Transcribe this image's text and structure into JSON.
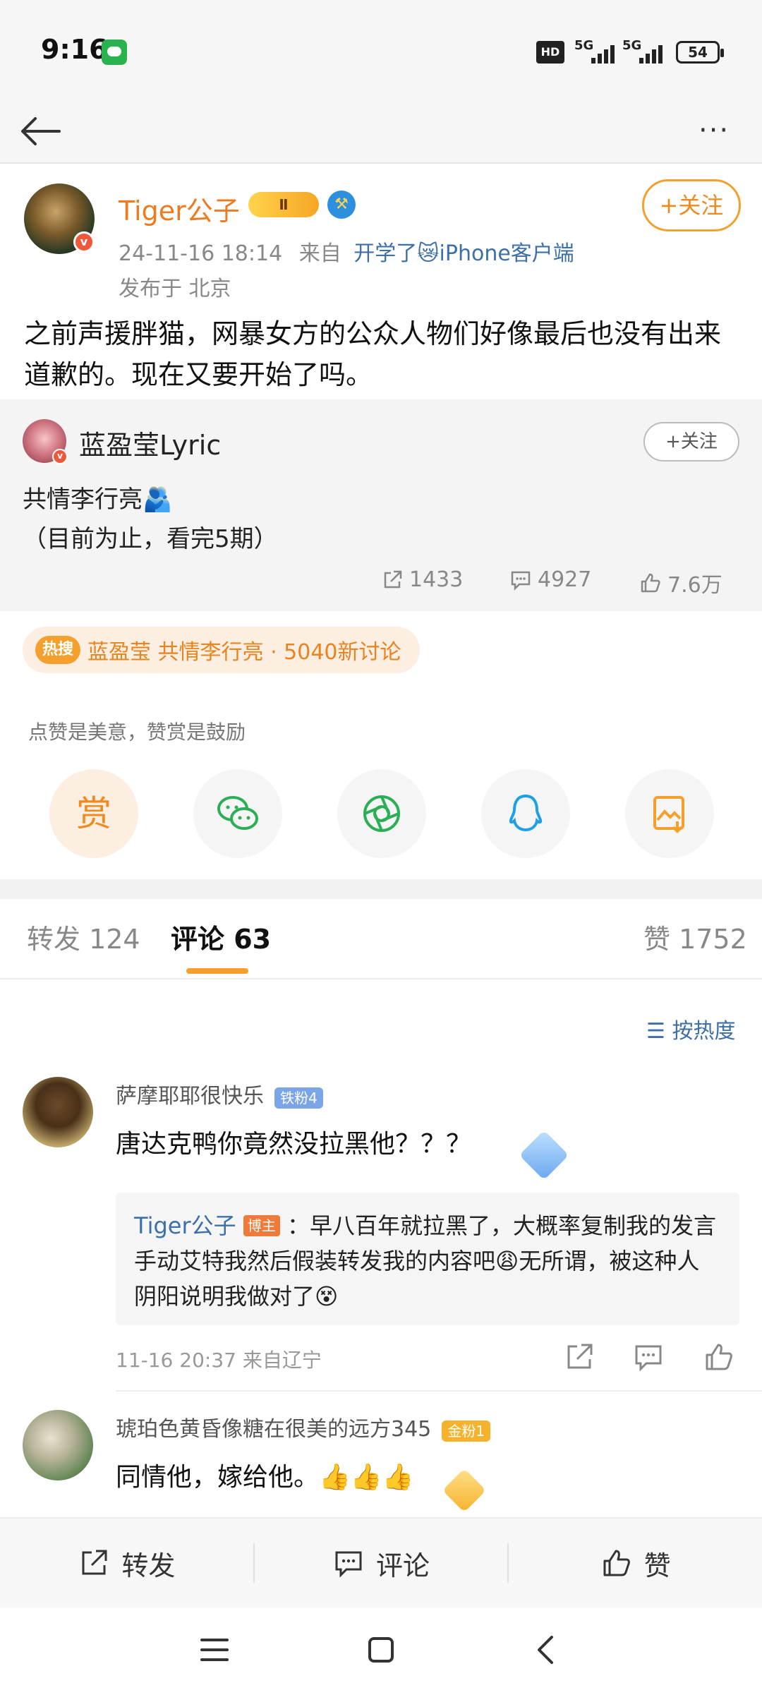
{
  "status_bar": {
    "time": "9:16",
    "hd_label": "HD",
    "network_1": "5G",
    "network_2": "5G",
    "battery": "54"
  },
  "nav": {
    "back_icon": "arrow-left-icon",
    "more_icon": "more-dots-icon",
    "more_label": "···"
  },
  "post": {
    "author": "Tiger公子",
    "verified_badge": "v",
    "crown_label": "Ⅱ",
    "level_icon": "hammer-badge-icon",
    "follow_label": "+关注",
    "date": "24-11-16 18:14",
    "source_prefix": "来自",
    "source": "开学了😿iPhone客户端",
    "location": "发布于 北京",
    "text": "之前声援胖猫，网暴女方的公众人物们好像最后也没有出来道歉的。现在又要开始了吗。"
  },
  "retweet": {
    "author": "蓝盈莹Lyric",
    "follow_label": "+关注",
    "line1": "共情李行亮🫂",
    "line2": "（目前为止，看完5期）",
    "reposts": "1433",
    "comments": "4927",
    "likes": "7.6万"
  },
  "hot_topic": {
    "tag": "热搜",
    "text": "蓝盈莹 共情李行亮 · 5040新讨论"
  },
  "reward": {
    "tip": "点赞是美意，赞赏是鼓励",
    "reward_label": "赏"
  },
  "tabs": {
    "repost": "转发 124",
    "comment": "评论 63",
    "like": "赞 1752"
  },
  "sort_label": "按热度",
  "comments": [
    {
      "name": "萨摩耶耶很快乐",
      "badge": "铁粉4",
      "text": "唐达克鸭你竟然没拉黑他？？？",
      "reply_author": "Tiger公子",
      "reply_badge": "博主",
      "reply_text": "：早八百年就拉黑了，大概率复制我的发言手动艾特我然后假装转发我的内容吧😩无所谓，被这种人阴阳说明我做对了😵",
      "meta": "11-16 20:37 来自辽宁"
    },
    {
      "name": "琥珀色黄昏像糖在很美的远方345",
      "badge": "金粉1",
      "text": "同情他，嫁给他。👍👍👍"
    }
  ],
  "toolbar": {
    "repost": "转发",
    "comment": "评论",
    "like": "赞"
  },
  "colors": {
    "orange": "#f07a1e",
    "link_blue": "#3d6fa8",
    "accent": "#f5a02c"
  }
}
